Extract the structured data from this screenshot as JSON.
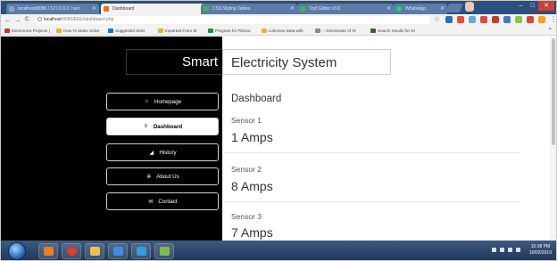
{
  "browser": {
    "tabs": [
      {
        "title": "localhost/8080 / 127.0.0.1 / sen",
        "favicon_color": "#8aa4c8",
        "active": false
      },
      {
        "title": "Dashboard",
        "favicon_color": "#e2731b",
        "active": true
      },
      {
        "title": "CSS Styling Tables",
        "favicon_color": "#4caf50",
        "active": false
      },
      {
        "title": "TryIt Editor v3.6",
        "favicon_color": "#4caf50",
        "active": false
      },
      {
        "title": "WhatsApp",
        "favicon_color": "#25d366",
        "active": false
      }
    ],
    "url_host": "localhost",
    "url_path": ":8080/EEE/dashboard.php",
    "nav": {
      "back": "←",
      "forward": "→",
      "reload": "C"
    },
    "window": {
      "minimize": "–",
      "maximize": "□",
      "close": "✕"
    },
    "bookmarks": [
      {
        "label": "Electronics Projects |",
        "color": "#c0392b"
      },
      {
        "label": "How To Make Solve",
        "color": "#555555"
      },
      {
        "label": "Suggested Sites",
        "color": "#1e73be"
      },
      {
        "label": "Imported From IE",
        "color": "#e8b32a"
      },
      {
        "label": "Program for Fibona",
        "color": "#1e8e3e"
      },
      {
        "label": "LinkView Data with",
        "color": "#e8b32a"
      },
      {
        "label": "-- Directorate of Te",
        "color": "#888888"
      },
      {
        "label": "Search results for DI",
        "color": "#2a6a1e"
      }
    ],
    "bookmarks_more": "»"
  },
  "app": {
    "brand": "Smart",
    "header_title": "Electricity System",
    "nav": [
      {
        "label": "Homepage",
        "icon": "⌂",
        "icon_name": "home-icon",
        "active": false
      },
      {
        "label": "Dashboard",
        "icon": "≡",
        "icon_name": "cart-icon",
        "active": true
      },
      {
        "label": "History",
        "icon": "◢",
        "icon_name": "chart-icon",
        "active": false
      },
      {
        "label": "About Us",
        "icon": "✲",
        "icon_name": "gears-icon",
        "active": false
      },
      {
        "label": "Contact",
        "icon": "✉",
        "icon_name": "envelope-icon",
        "active": false
      }
    ],
    "dashboard_title": "Dashboard",
    "sensors": [
      {
        "label": "Sensor 1",
        "value": "1 Amps"
      },
      {
        "label": "Sensor 2",
        "value": "8 Amps"
      },
      {
        "label": "Sensor 3",
        "value": "7 Amps"
      }
    ]
  },
  "taskbar": {
    "time": "10:38 PM",
    "date": "10/02/2019",
    "apps": [
      {
        "name": "media-player",
        "color": "#f07d1e"
      },
      {
        "name": "chrome",
        "color": "#e33b2e"
      },
      {
        "name": "file-explorer",
        "color": "#f1c04b"
      },
      {
        "name": "edge",
        "color": "#3a8ee6"
      },
      {
        "name": "app-blue",
        "color": "#2f9de0"
      },
      {
        "name": "app-green",
        "color": "#7bbf4a"
      }
    ]
  }
}
